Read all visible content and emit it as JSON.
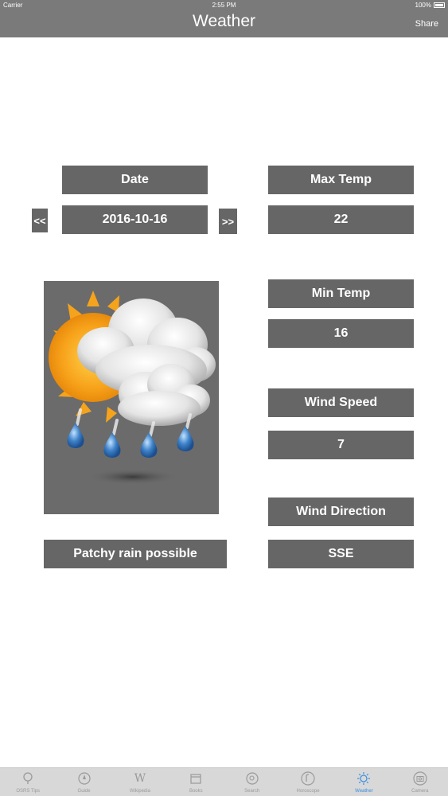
{
  "status_bar": {
    "carrier": "Carrier",
    "time": "2:55 PM",
    "battery": "100%"
  },
  "nav": {
    "title": "Weather",
    "share_label": "Share"
  },
  "date": {
    "label": "Date",
    "value": "2016-10-16",
    "prev_label": "<<",
    "next_label": ">>"
  },
  "max_temp": {
    "label": "Max Temp",
    "value": "22"
  },
  "min_temp": {
    "label": "Min Temp",
    "value": "16"
  },
  "wind_speed": {
    "label": "Wind Speed",
    "value": "7"
  },
  "wind_direction": {
    "label": "Wind Direction",
    "value": "SSE"
  },
  "condition": {
    "text": "Patchy rain possible",
    "icon": "patchy-rain-icon"
  },
  "tab_bar": {
    "items": [
      {
        "label": "OSRS Tips",
        "icon": "search-icon"
      },
      {
        "label": "Guide",
        "icon": "compass-icon"
      },
      {
        "label": "Wikipedia",
        "icon": "wikipedia-icon"
      },
      {
        "label": "Books",
        "icon": "calendar-icon"
      },
      {
        "label": "Search",
        "icon": "search-circle-icon"
      },
      {
        "label": "Horoscope",
        "icon": "horoscope-icon"
      },
      {
        "label": "Weather",
        "icon": "sun-icon",
        "active": true
      },
      {
        "label": "Camera",
        "icon": "camera-icon"
      }
    ]
  },
  "colors": {
    "bar": "#7a7a7a",
    "box": "#666666",
    "tab_active": "#3a8ee0",
    "tab_inactive": "#9a9a9a"
  }
}
